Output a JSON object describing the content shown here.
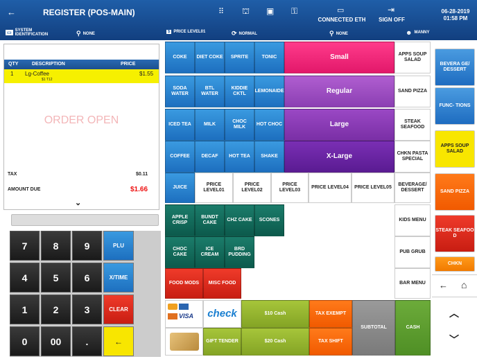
{
  "header": {
    "title": "REGISTER (POS-MAIN)",
    "connection": "CONNECTED ETH",
    "sign_off": "SIGN OFF",
    "date": "06-28-2019",
    "time": "01:58 PM",
    "system_id": "SYSTEM IDENTIFICATION",
    "none1": "NONE",
    "price_level": "PRICE LEVEL01",
    "normal": "NORMAL",
    "none2": "NONE",
    "user": "MANNY"
  },
  "order": {
    "col_qty": "QTY",
    "col_desc": "DESCRIPTION",
    "col_price": "PRICE",
    "item_qty": "1",
    "item_desc": "Lg-Coffee",
    "item_sub": "$1 T12",
    "item_price": "$1.55",
    "watermark": "ORDER OPEN",
    "tax_label": "TAX",
    "tax_value": "$0.11",
    "due_label": "AMOUNT DUE",
    "due_value": "$1.66"
  },
  "keypad": {
    "k7": "7",
    "k8": "8",
    "k9": "9",
    "plu": "PLU",
    "k4": "4",
    "k5": "5",
    "k6": "6",
    "xtime": "X/TIME",
    "k1": "1",
    "k2": "2",
    "k3": "3",
    "clear": "CLEAR",
    "k0": "0",
    "k00": "00",
    "dot": ".",
    "back": "←"
  },
  "grid": {
    "coke": "COKE",
    "diet": "DIET COKE",
    "sprite": "SPRITE",
    "tonic": "TONIC",
    "soda": "SODA WATER",
    "btl": "BTL WATER",
    "kiddie": "KIDDIE CKTL",
    "lemon": "LEMONAIDE",
    "iced": "ICED TEA",
    "milk": "MILK",
    "choc": "CHOC MILK",
    "hotchoc": "HOT CHOC",
    "coffee": "COFFEE",
    "decaf": "DECAF",
    "hottea": "HOT TEA",
    "shake": "SHAKE",
    "juice": "JUICE",
    "pl1": "PRICE LEVEL01",
    "pl2": "PRICE LEVEL02",
    "pl3": "PRICE LEVEL03",
    "pl4": "PRICE LEVEL04",
    "pl5": "PRICE LEVEL05",
    "apple": "APPLE CRISP",
    "bundt": "BUNDT CAKE",
    "chz": "CHZ CAKE",
    "scones": "SCONES",
    "choccake": "CHOC CAKE",
    "icecream": "ICE CREAM",
    "bird": "BRD PUDDING",
    "foodmods": "FOOD MODS",
    "miscfood": "MISC FOOD",
    "small": "Small",
    "regular": "Regular",
    "large": "Large",
    "xlarge": "X-Large",
    "apps": "APPS SOUP SALAD",
    "sand": "SAND PIZZA",
    "steak": "STEAK SEAFOOD",
    "chkn": "CHKN PASTA SPECIAL",
    "bevdes": "BEVERAGE/ DESSERT",
    "kids": "KIDS MENU",
    "pub": "PUB GRUB",
    "bar": "BAR MENU",
    "check": "check",
    "gift": "GIFT TENDER",
    "cash10": "$10 Cash",
    "cash20": "$20 Cash",
    "taxexempt": "TAX EXEMPT",
    "taxshift": "TAX SHIFT",
    "subtotal": "SUBTOTAL",
    "cash": "CASH"
  },
  "nav": {
    "bev": "BEVERA GE/ DESSERT",
    "func": "FUNC- TIONS",
    "apps": "APPS SOUP SALAD",
    "sand": "SAND PIZZA",
    "steak": "STEAK SEAFOO D",
    "chkn": "CHKN"
  }
}
